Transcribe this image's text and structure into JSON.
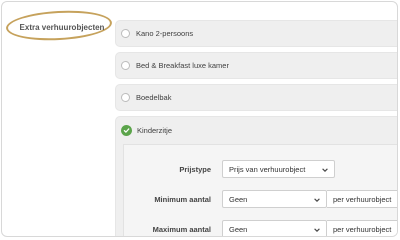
{
  "section": {
    "label": "Extra verhuurobjecten"
  },
  "options": [
    {
      "label": "Kano 2-persoons",
      "selected": false
    },
    {
      "label": "Bed & Breakfast luxe kamer",
      "selected": false
    },
    {
      "label": "Boedelbak",
      "selected": false
    },
    {
      "label": "Kinderzitje",
      "selected": true
    }
  ],
  "settings": {
    "price_type": {
      "label": "Prijstype",
      "value": "Prijs van verhuurobject"
    },
    "minimum": {
      "label": "Minimum aantal",
      "value": "Geen",
      "unit": "per verhuurobject"
    },
    "maximum": {
      "label": "Maximum aantal",
      "value": "Geen",
      "unit": "per verhuurobject"
    }
  },
  "colors": {
    "check": "#5ba44a",
    "highlight": "#c6a25c"
  },
  "icons": {
    "check": "check-circle-icon",
    "dropdown": "chevron-down-icon"
  }
}
